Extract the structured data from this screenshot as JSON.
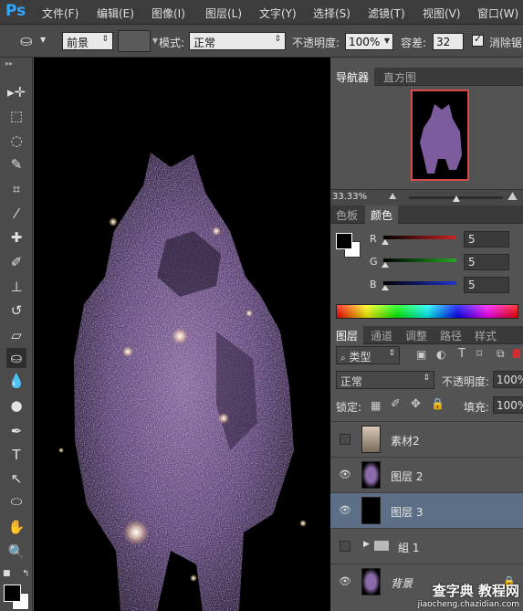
{
  "app": {
    "logo": "Ps"
  },
  "menu": [
    "文件(F)",
    "编辑(E)",
    "图像(I)",
    "图层(L)",
    "文字(Y)",
    "选择(S)",
    "滤镜(T)",
    "视图(V)",
    "窗口(W)"
  ],
  "options": {
    "fill_source": "前景",
    "mode_label": "模式:",
    "mode_value": "正常",
    "opacity_label": "不透明度:",
    "opacity_value": "100%",
    "tolerance_label": "容差:",
    "tolerance_value": "32",
    "antialias_label": "消除锯"
  },
  "toolbox": {
    "tools": [
      {
        "name": "move-tool-icon",
        "glyph": "▸✛"
      },
      {
        "name": "marquee-tool-icon",
        "glyph": "⬚"
      },
      {
        "name": "lasso-tool-icon",
        "glyph": "◌"
      },
      {
        "name": "quick-select-tool-icon",
        "glyph": "✎"
      },
      {
        "name": "crop-tool-icon",
        "glyph": "⌗"
      },
      {
        "name": "eyedropper-tool-icon",
        "glyph": "⁄"
      },
      {
        "name": "healing-brush-tool-icon",
        "glyph": "✚"
      },
      {
        "name": "brush-tool-icon",
        "glyph": "✐"
      },
      {
        "name": "clone-stamp-tool-icon",
        "glyph": "⊥"
      },
      {
        "name": "history-brush-tool-icon",
        "glyph": "↺"
      },
      {
        "name": "eraser-tool-icon",
        "glyph": "▱"
      },
      {
        "name": "paint-bucket-tool-icon",
        "glyph": "⛀"
      },
      {
        "name": "blur-tool-icon",
        "glyph": "💧"
      },
      {
        "name": "dodge-tool-icon",
        "glyph": "●"
      },
      {
        "name": "pen-tool-icon",
        "glyph": "✒"
      },
      {
        "name": "type-tool-icon",
        "glyph": "T"
      },
      {
        "name": "path-select-tool-icon",
        "glyph": "↖"
      },
      {
        "name": "ellipse-tool-icon",
        "glyph": "⬭"
      },
      {
        "name": "hand-tool-icon",
        "glyph": "✋"
      },
      {
        "name": "zoom-tool-icon",
        "glyph": "🔍"
      }
    ],
    "active_tool": "paint-bucket-tool-icon",
    "foreground": "#000000",
    "background": "#ffffff"
  },
  "navigator": {
    "tabs": [
      "导航器",
      "直方图"
    ],
    "zoom": "33.33%",
    "zoom_level": 0.5
  },
  "color_panel": {
    "tabs": [
      "色板",
      "颜色"
    ],
    "sliders": [
      {
        "label": "R",
        "value": "5",
        "color": "#cc2222"
      },
      {
        "label": "G",
        "value": "5",
        "color": "#22aa22"
      },
      {
        "label": "B",
        "value": "5",
        "color": "#2233cc"
      }
    ]
  },
  "layers_panel": {
    "tabs": [
      "图层",
      "通道",
      "调整",
      "路径",
      "样式"
    ],
    "filter_label": "类型",
    "blend_mode": "正常",
    "opacity_label": "不透明度:",
    "opacity_value": "100%",
    "lock_label": "锁定:",
    "fill_label": "填充:",
    "fill_value": "100%",
    "layers": [
      {
        "name": "素材2",
        "visible": false,
        "selected": false,
        "thumb": "cat"
      },
      {
        "name": "图层 2",
        "visible": true,
        "selected": false,
        "thumb": "galaxy"
      },
      {
        "name": "图层 3",
        "visible": true,
        "selected": true,
        "thumb": "black"
      },
      {
        "name": "組 1",
        "visible": false,
        "selected": false,
        "thumb": "folder"
      },
      {
        "name": "背景",
        "visible": true,
        "selected": false,
        "thumb": "galaxy",
        "locked": true
      }
    ]
  },
  "watermark": {
    "main": "查字典 教程网",
    "url": "jiaocheng.chazidian.com"
  }
}
